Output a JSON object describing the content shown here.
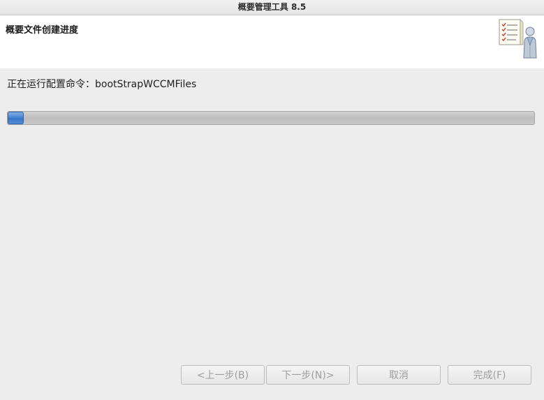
{
  "window": {
    "title": "概要管理工具 8.5"
  },
  "banner": {
    "title": "概要文件创建进度",
    "icon": "checklist-user-icon"
  },
  "status": {
    "text": "正在运行配置命令：bootStrapWCCMFiles"
  },
  "progress": {
    "percent": 3,
    "color": "#4a86d6"
  },
  "buttons": {
    "back": "<上一步(B)",
    "next": "下一步(N)>",
    "cancel": "取消",
    "finish": "完成(F)"
  }
}
